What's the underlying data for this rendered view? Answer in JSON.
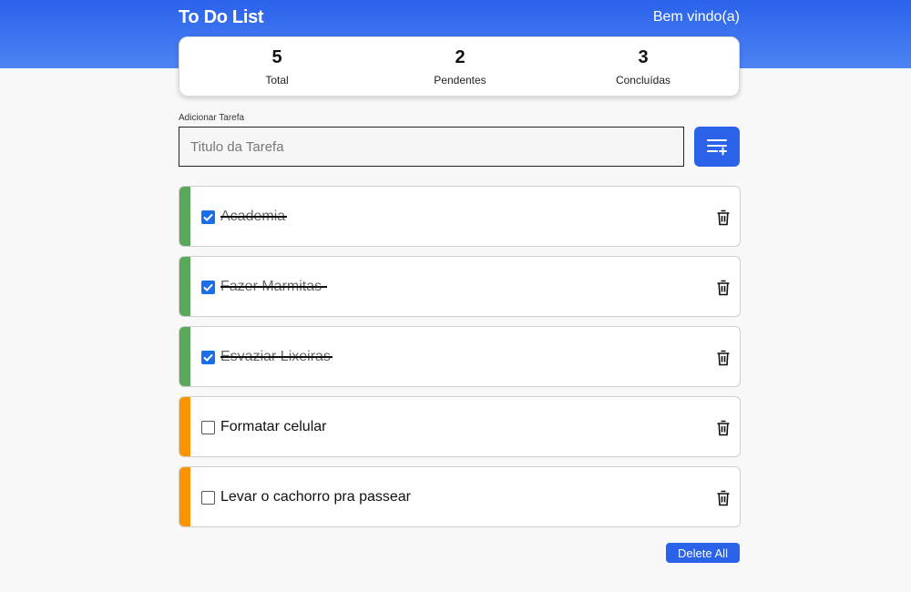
{
  "header": {
    "title": "To Do List",
    "welcome": "Bem vindo(a)",
    "accent_color": "#2a62ea"
  },
  "stats": {
    "total": {
      "value": "5",
      "label": "Total"
    },
    "pending": {
      "value": "2",
      "label": "Pendentes"
    },
    "completed": {
      "value": "3",
      "label": "Concluídas"
    }
  },
  "form": {
    "label": "Adicionar Tarefa",
    "placeholder": "Titulo da Tarefa",
    "value": "",
    "add_icon": "playlist-add-icon"
  },
  "tasks": [
    {
      "title": "Academia",
      "completed": true,
      "status_color": "#5aa85a"
    },
    {
      "title": "Fazer Marmitas",
      "completed": true,
      "status_color": "#5aa85a"
    },
    {
      "title": "Esvaziar Lixeiras",
      "completed": true,
      "status_color": "#5aa85a"
    },
    {
      "title": "Formatar celular",
      "completed": false,
      "status_color": "#fb9400"
    },
    {
      "title": "Levar o cachorro pra passear",
      "completed": false,
      "status_color": "#fb9400"
    }
  ],
  "actions": {
    "delete_all_label": "Delete All",
    "delete_icon": "trash-icon"
  }
}
